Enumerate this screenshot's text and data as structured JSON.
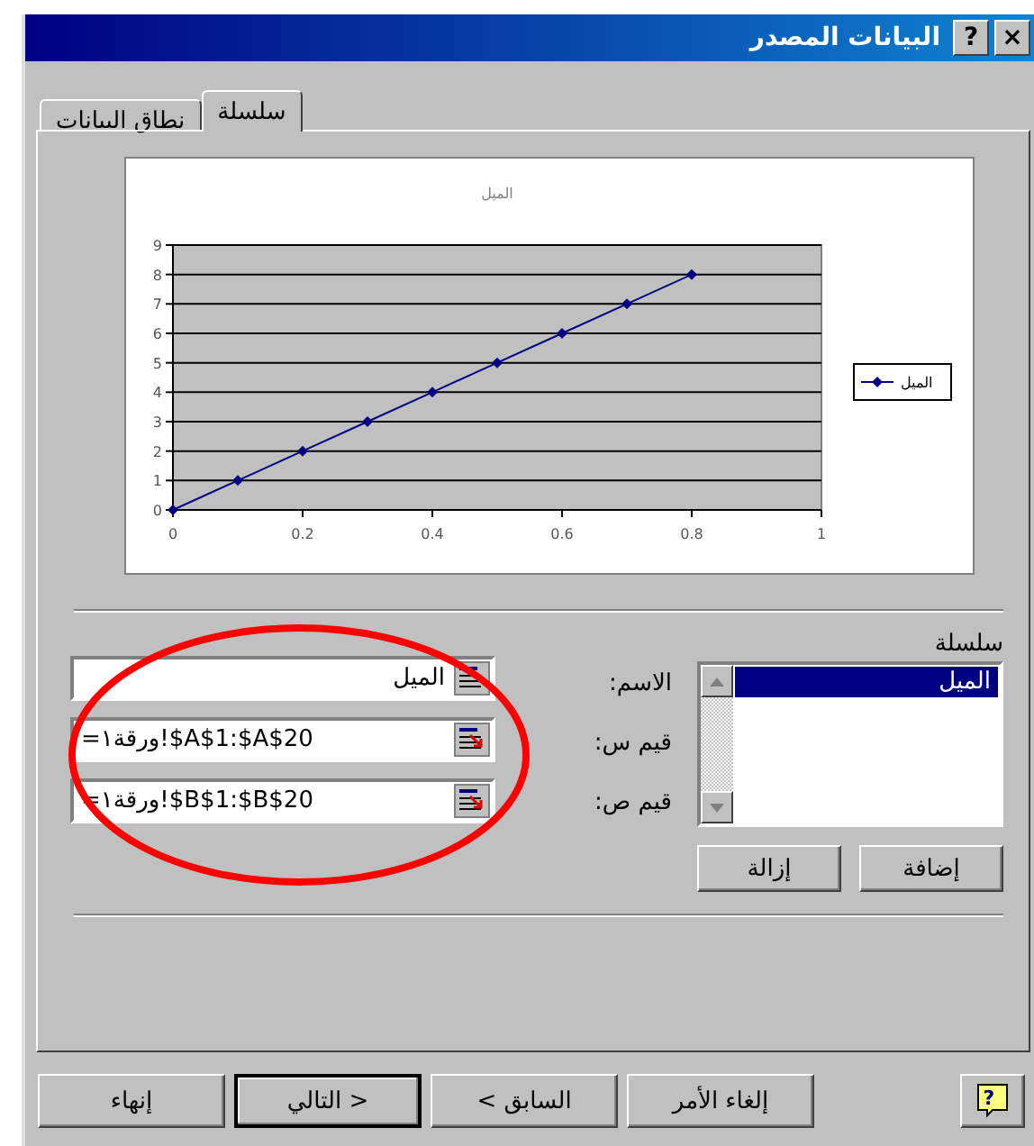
{
  "window": {
    "title": "البيانات المصدر",
    "help_button": "?",
    "close_button": "×"
  },
  "tabs": [
    {
      "label": "سلسلة",
      "selected": true
    },
    {
      "label": "نطاق البيانات",
      "selected": false
    }
  ],
  "chart": {
    "chart_data": {
      "type": "line",
      "title": "الميل",
      "x": [
        0,
        0.1,
        0.2,
        0.3,
        0.4,
        0.5,
        0.6,
        0.7,
        0.8
      ],
      "series": [
        {
          "name": "الميل",
          "color": "#000080",
          "values": [
            0,
            1,
            2,
            3,
            4,
            5,
            6,
            7,
            8
          ]
        }
      ],
      "xlim": [
        0,
        1
      ],
      "ylim": [
        0,
        9
      ],
      "grid": true,
      "marker": true,
      "xticks": [
        0,
        0.2,
        0.4,
        0.6,
        0.8,
        1
      ],
      "yticks": [
        0,
        1,
        2,
        3,
        4,
        5,
        6,
        7,
        8,
        9
      ]
    }
  },
  "series_section": {
    "label": "سلسلة",
    "items": [
      {
        "label": "الميل",
        "selected": true
      }
    ],
    "add_button": "إضافة",
    "remove_button": "إزالة"
  },
  "fields": [
    {
      "label": "الاسم:",
      "value": "الميل",
      "kind": "name"
    },
    {
      "label": "قيم س:",
      "value": "=ورقة١!$A$1:$A$20",
      "kind": "range"
    },
    {
      "label": "قيم ص:",
      "value": "=ورقة١!$B$1:$B$20",
      "kind": "range"
    }
  ],
  "help_button": "?",
  "buttons": [
    {
      "label": "إلغاء الأمر",
      "default": false
    },
    {
      "label": "< السابق",
      "default": false
    },
    {
      "label": "التالي >",
      "default": true
    },
    {
      "label": "إنهاء",
      "default": false
    }
  ]
}
